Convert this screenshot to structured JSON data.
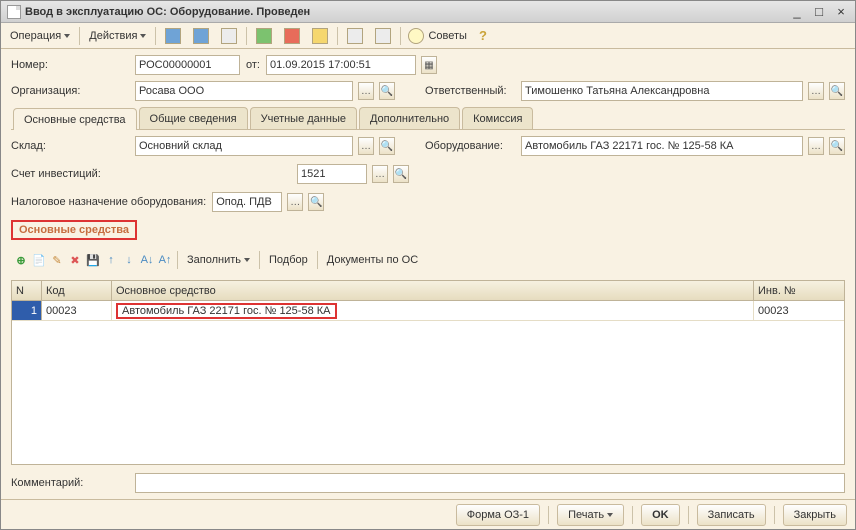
{
  "window": {
    "title": "Ввод в эксплуатацию ОС: Оборудование. Проведен"
  },
  "toolbar": {
    "operation": "Операция",
    "actions": "Действия",
    "hints": "Советы"
  },
  "labels": {
    "number": "Номер:",
    "from": "от:",
    "organisation": "Организация:",
    "responsible": "Ответственный:",
    "warehouse": "Склад:",
    "equipment": "Оборудование:",
    "investAccount": "Счет инвестиций:",
    "taxPurpose": "Налоговое назначение оборудования:",
    "comment": "Комментарий:"
  },
  "fields": {
    "number": "РОС00000001",
    "date": "01.09.2015 17:00:51",
    "organisation": "Росава ООО",
    "responsible": "Тимошенко Татьяна Александровна",
    "warehouse": "Основний склад",
    "equipment": "Автомобиль ГАЗ 22171 гос. № 125-58 КА",
    "investAccount": "1521",
    "taxPurpose": "Опод. ПДВ",
    "comment": ""
  },
  "tabs": [
    {
      "id": "main",
      "label": "Основные средства"
    },
    {
      "id": "general",
      "label": "Общие сведения"
    },
    {
      "id": "account",
      "label": "Учетные данные"
    },
    {
      "id": "extra",
      "label": "Дополнительно"
    },
    {
      "id": "commission",
      "label": "Комиссия"
    }
  ],
  "activeTab": "main",
  "section": {
    "title": "Основные средства"
  },
  "subtoolbar": {
    "fill": "Заполнить",
    "select": "Подбор",
    "docs": "Документы по ОС"
  },
  "grid": {
    "columns": {
      "n": "N",
      "code": "Код",
      "main": "Основное средство",
      "inv": "Инв. №"
    },
    "rows": [
      {
        "n": "1",
        "code": "00023",
        "name": "Автомобиль ГАЗ 22171 гос. № 125-58 КА",
        "inv": "00023"
      }
    ]
  },
  "footer": {
    "form": "Форма ОЗ-1",
    "print": "Печать",
    "ok": "OK",
    "save": "Записать",
    "close": "Закрыть"
  }
}
